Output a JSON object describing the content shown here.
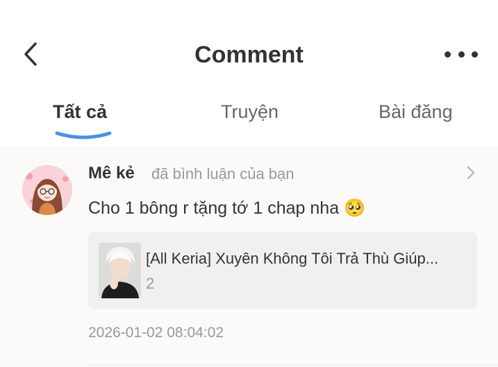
{
  "header": {
    "back_icon": "chevron-left-icon",
    "title": "Comment",
    "more_icon": "more-horizontal-icon"
  },
  "tabs": [
    {
      "label": "Tất cả",
      "active": true
    },
    {
      "label": "Truyện",
      "active": false
    },
    {
      "label": "Bài đăng",
      "active": false
    }
  ],
  "colors": {
    "accent": "#4a90e2",
    "text_primary": "#333333",
    "text_secondary": "#999999",
    "content_bg": "#fbfaf8",
    "card_bg": "#f1f0ee"
  },
  "notification": {
    "username": "Mê kẻ",
    "action": "đã bình luận của bạn",
    "comment": "Cho 1 bông r tặng tớ 1 chap nha 🥺",
    "story": {
      "title": "[All Keria] Xuyên Không Tôi Trả Thù Giúp...",
      "count": "2"
    },
    "timestamp": "2026-01-02 08:04:02"
  }
}
